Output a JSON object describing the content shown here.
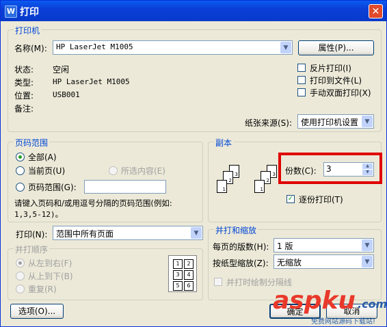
{
  "window": {
    "title": "打印",
    "app_icon": "W",
    "close_glyph": "✕"
  },
  "printer": {
    "group_title": "打印机",
    "name_label": "名称(M):",
    "name_value": "HP LaserJet M1005",
    "properties_button": "属性(P)...",
    "status_label": "状态:",
    "status_value": "空闲",
    "type_label": "类型:",
    "type_value": "HP LaserJet M1005",
    "location_label": "位置:",
    "location_value": "USB001",
    "comment_label": "备注:",
    "reverse_print": "反片打印(I)",
    "print_to_file": "打印到文件(L)",
    "manual_duplex": "手动双面打印(X)",
    "paper_source_label": "纸张来源(S):",
    "paper_source_value": "使用打印机设置"
  },
  "page_range": {
    "group_title": "页码范围",
    "all": "全部(A)",
    "current": "当前页(U)",
    "selection": "所选内容(E)",
    "pages": "页码范围(G):",
    "hint": "请键入页码和/或用逗号分隔的页码范围(例如:",
    "hint_example": "1,3,5-12)。"
  },
  "copies": {
    "group_title": "副本",
    "count_label": "份数(C):",
    "count_value": "3",
    "collate": "逐份打印(T)",
    "stack_a": [
      "3",
      "2",
      "1"
    ],
    "stack_b": [
      "3",
      "2",
      "1"
    ]
  },
  "print_what": {
    "label": "打印(N):",
    "value": "范围中所有页面"
  },
  "order": {
    "group_title": "并打顺序",
    "left_right": "从左到右(F)",
    "top_bottom": "从上到下(B)",
    "repeat": "重复(R)",
    "grid": [
      "1",
      "2",
      "3",
      "4",
      "5",
      "6"
    ]
  },
  "zoom": {
    "group_title": "并打和缩放",
    "per_sheet_label": "每页的版数(H):",
    "per_sheet_value": "1 版",
    "scale_label": "按纸型缩放(Z):",
    "scale_value": "无缩放",
    "draw_borders": "并打时绘制分隔线"
  },
  "buttons": {
    "options": "选项(O)...",
    "ok": "确定",
    "cancel": "取消"
  },
  "watermark": {
    "brand": "aspku",
    "tld": ".com",
    "slogan": "免费网站源码下载站!"
  },
  "colors": {
    "accent": "#0046D5",
    "highlight": "#E00000"
  }
}
